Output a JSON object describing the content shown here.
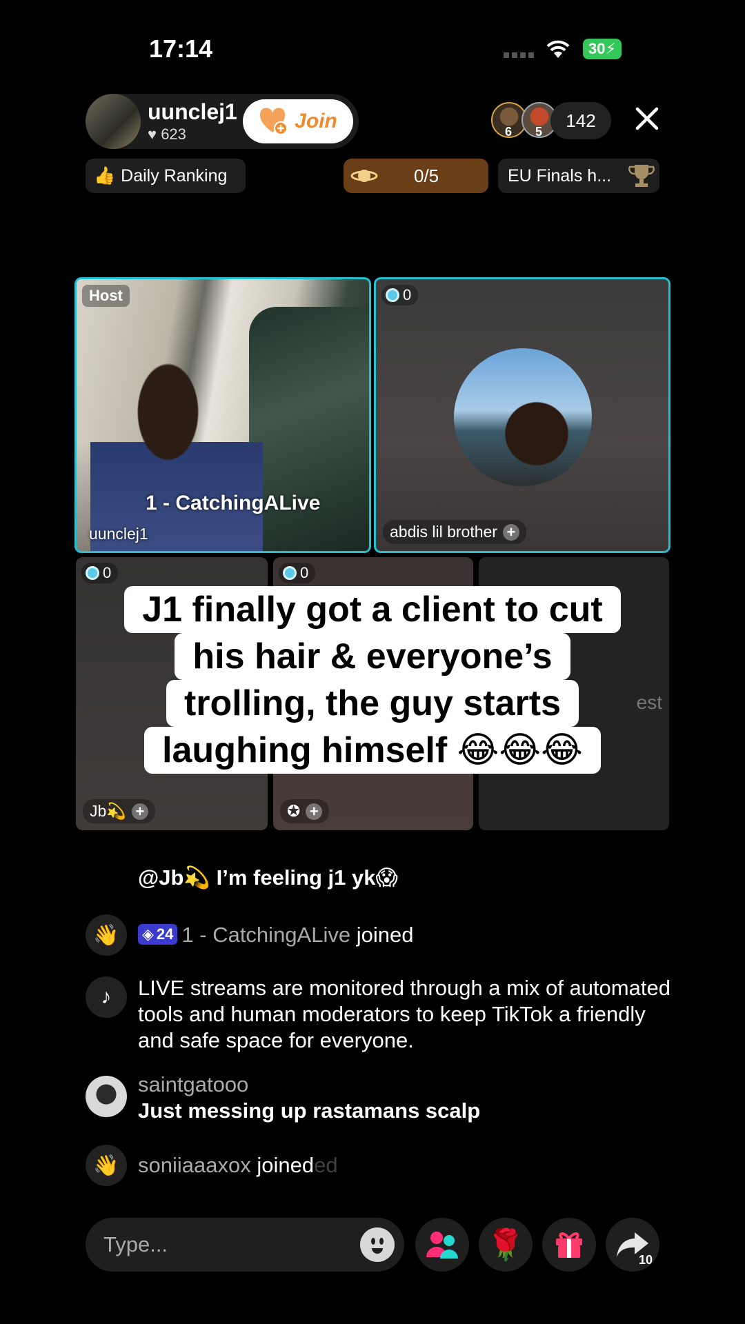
{
  "status": {
    "time": "17:14",
    "battery": "30"
  },
  "host": {
    "name": "uunclej1",
    "likes": "623",
    "join_label": "Join"
  },
  "viewers": {
    "avatar1_level": "6",
    "avatar2_level": "5",
    "count": "142"
  },
  "pills": {
    "ranking": "Daily Ranking",
    "goal": "0/5",
    "event": "EU Finals h..."
  },
  "grid": {
    "host_badge": "Host",
    "host_overlay": "1 - CatchingALive",
    "host_tile_name": "uunclej1",
    "guest1_score": "0",
    "guest1_name": "abdis lil brother",
    "guest2_score": "0",
    "guest2_name": "Jb💫",
    "guest3_score": "0",
    "guest4_hint": "est"
  },
  "caption": {
    "lines": [
      "J1 finally got a client to cut",
      "his hair & everyone’s",
      "trolling, the guy starts",
      "laughing himself 😂😂😂"
    ]
  },
  "comments": [
    {
      "text": "@Jb💫 I’m feeling j1 yk😱"
    },
    {
      "level": "24",
      "user": "1 - CatchingALive",
      "action": "joined"
    },
    {
      "text": "LIVE streams are monitored through a mix of automated tools and human moderators to keep TikTok a friendly and safe space for everyone."
    },
    {
      "user": "saintgatooo",
      "text": "Just messing up rastamans scalp"
    },
    {
      "user": "soniiaaaxox",
      "action": "joined",
      "fade": "ed"
    }
  ],
  "bottom": {
    "placeholder": "Type...",
    "share_count": "10"
  }
}
